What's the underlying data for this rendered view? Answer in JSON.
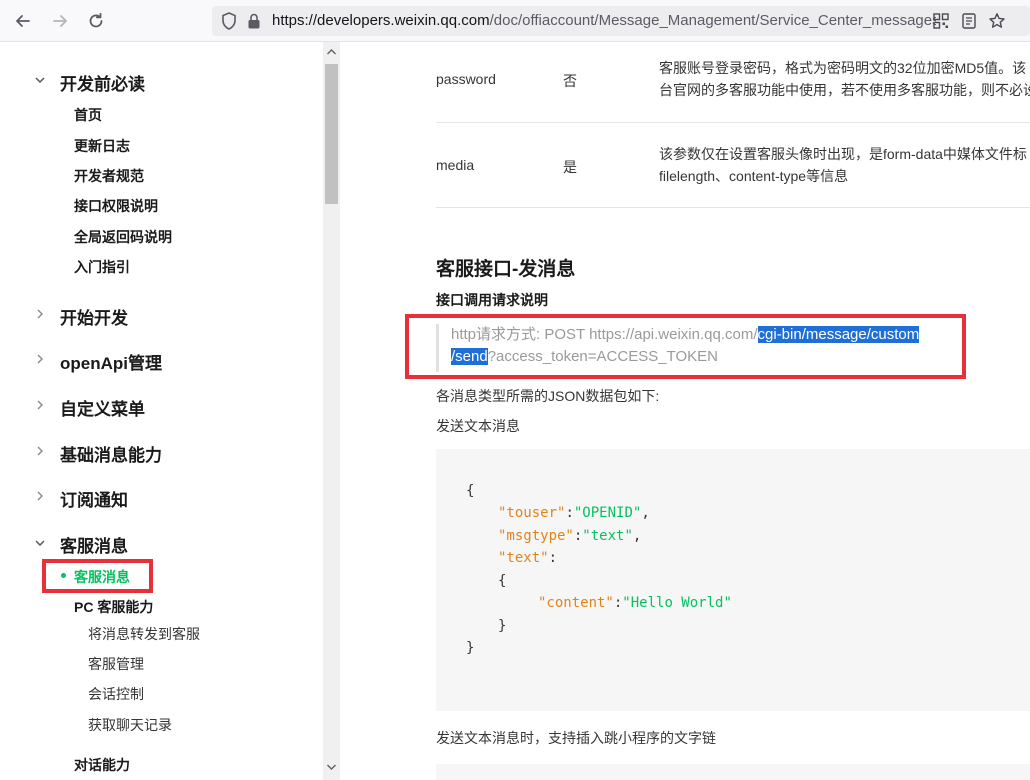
{
  "browser": {
    "url_host": "https://developers.weixin.qq.com",
    "url_path": "/doc/offiaccount/Message_Management/Service_Center_messages.html"
  },
  "sidebar": {
    "sections": [
      {
        "label": "开发前必读",
        "expanded": true
      },
      {
        "label": "开始开发",
        "expanded": false
      },
      {
        "label": "openApi管理",
        "expanded": false
      },
      {
        "label": "自定义菜单",
        "expanded": false
      },
      {
        "label": "基础消息能力",
        "expanded": false
      },
      {
        "label": "订阅通知",
        "expanded": false
      },
      {
        "label": "客服消息",
        "expanded": true
      }
    ],
    "intro_items": [
      "首页",
      "更新日志",
      "开发者规范",
      "接口权限说明",
      "全局返回码说明",
      "入门指引"
    ],
    "kf_active": "客服消息",
    "kf_group_pc": "PC 客服能力",
    "kf_pc_items": [
      "将消息转发到客服",
      "客服管理",
      "会话控制",
      "获取聊天记录"
    ],
    "kf_group_dialog": "对话能力"
  },
  "main": {
    "params": [
      {
        "name": "password",
        "required": "否",
        "desc_lines": [
          "客服账号登录密码，格式为密码明文的32位加密MD5值。该",
          "台官网的多客服功能中使用，若不使用多客服功能，则不必设"
        ]
      },
      {
        "name": "media",
        "required": "是",
        "desc_lines": [
          "该参数仅在设置客服头像时出现，是form-data中媒体文件标",
          "filelength、content-type等信息"
        ]
      }
    ],
    "heading": "客服接口-发消息",
    "subheading": "接口调用请求说明",
    "request": {
      "prefix": "http请求方式: POST https://api.weixin.qq.com/",
      "highlight1": "cgi-bin/message/custom",
      "highlight2": "/send",
      "suffix": "?access_token=ACCESS_TOKEN"
    },
    "json_intro": "各消息类型所需的JSON数据包如下:",
    "send_text_label": "发送文本消息",
    "code": {
      "open": "{",
      "k_touser": "\"touser\"",
      "v_touser": "\"OPENID\"",
      "k_msgtype": "\"msgtype\"",
      "v_msgtype": "\"text\"",
      "k_text": "\"text\"",
      "inner_open": "{",
      "k_content": "\"content\"",
      "v_content": "\"Hello World\"",
      "inner_close": "}",
      "close": "}"
    },
    "link_note": "发送文本消息时，支持插入跳小程序的文字链"
  }
}
